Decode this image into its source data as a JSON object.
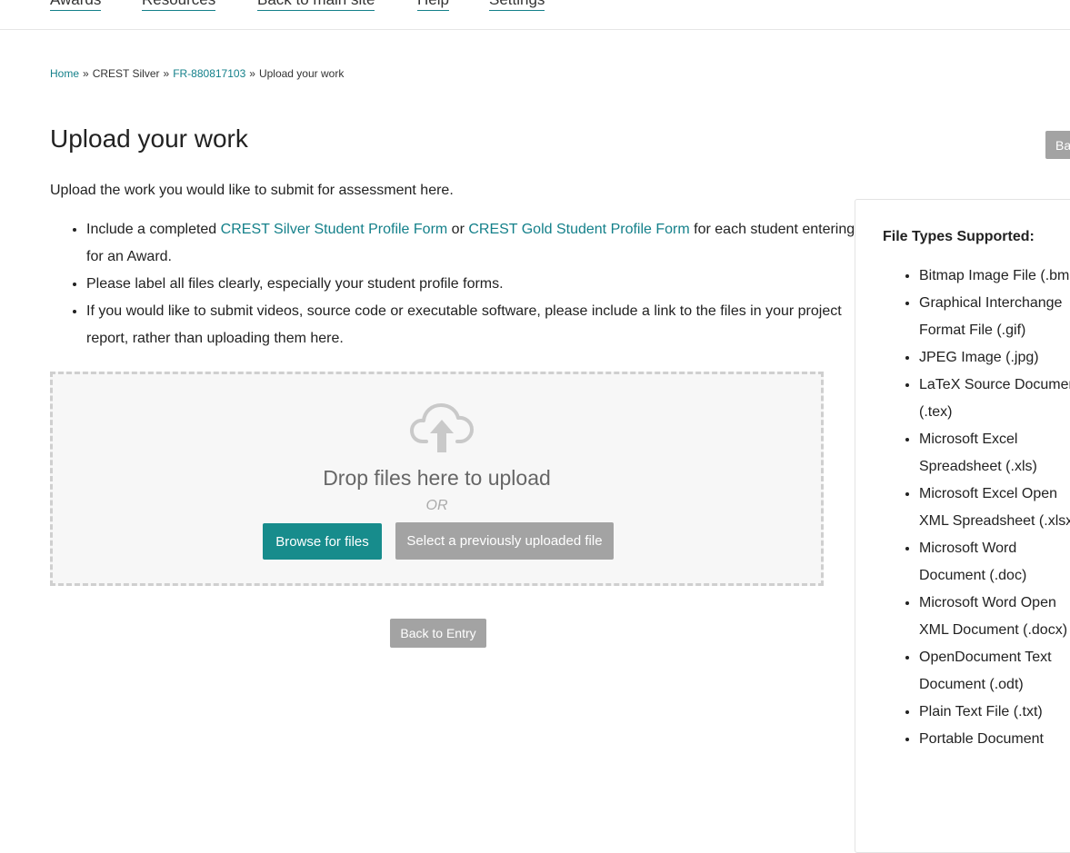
{
  "nav": {
    "items": [
      "Awards",
      "Resources",
      "Back to main site",
      "Help",
      "Settings"
    ]
  },
  "breadcrumb": {
    "home": "Home",
    "sep": "»",
    "award": "CREST Silver",
    "entry": "FR-880817103",
    "current": "Upload your work"
  },
  "page": {
    "title": "Upload your work",
    "intro": "Upload the work you would like to submit for assessment here.",
    "bullet1_pre": "Include a completed ",
    "bullet1_link1": "CREST Silver Student Profile Form",
    "bullet1_mid": " or ",
    "bullet1_link2": "CREST Gold Student Profile Form",
    "bullet1_post": " for each student entering for an Award.",
    "bullet2": "Please label all files clearly, especially your student profile forms.",
    "bullet3": "If you would like to submit videos, source code or executable software, please include a link to the files in your project report, rather than uploading them here."
  },
  "dropzone": {
    "icon": "cloud-upload-icon",
    "text": "Drop files here to upload",
    "or": "OR",
    "browse_label": "Browse for files",
    "select_label": "Select a previously uploaded file"
  },
  "actions": {
    "back_to_entry": "Back to Entry",
    "back_right": "Back"
  },
  "sidebar": {
    "title": "File Types Supported:",
    "types": [
      "Bitmap Image File (.bmp)",
      "Graphical Interchange Format File (.gif)",
      "JPEG Image (.jpg)",
      "LaTeX Source Document (.tex)",
      "Microsoft Excel Spreadsheet (.xls)",
      "Microsoft Excel Open XML Spreadsheet (.xlsx)",
      "Microsoft Word Document (.doc)",
      "Microsoft Word Open XML Document (.docx)",
      "OpenDocument Text Document (.odt)",
      "Plain Text File (.txt)",
      "Portable Document"
    ]
  },
  "colors": {
    "accent": "#178c8c",
    "link": "#14808a",
    "muted_button": "#a3a3a3"
  }
}
